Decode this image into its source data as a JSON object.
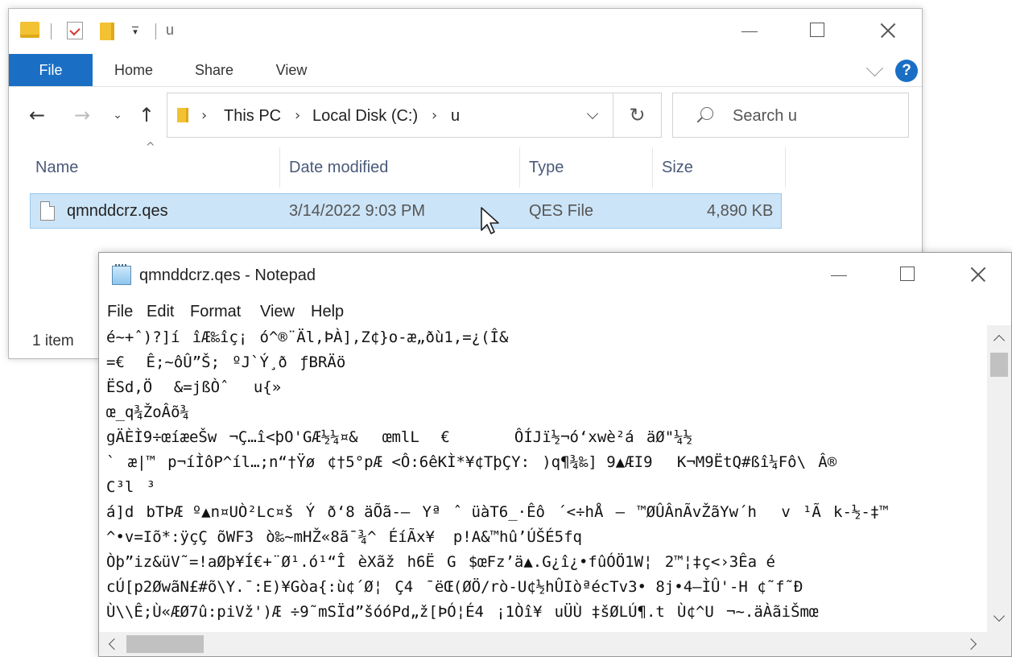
{
  "explorer": {
    "title": "u",
    "ribbon_tabs": [
      "File",
      "Home",
      "Share",
      "View"
    ],
    "help_label": "?",
    "breadcrumb": [
      "This PC",
      "Local Disk (C:)",
      "u"
    ],
    "search_placeholder": "Search u",
    "columns": [
      "Name",
      "Date modified",
      "Type",
      "Size"
    ],
    "files": [
      {
        "name": "qmnddcrz.qes",
        "date": "3/14/2022 9:03 PM",
        "type": "QES File",
        "size": "4,890 KB",
        "selected": true
      }
    ],
    "status": "1 item",
    "accent_color": "#1a6fc4",
    "selection_color": "#cce4f7"
  },
  "notepad": {
    "title": "qmnddcrz.qes - Notepad",
    "menu": [
      "File",
      "Edit",
      "Format",
      "View",
      "Help"
    ],
    "lines": [
      "é~+ˆ)?]íîÆ‰îç¡ó^®¨Äl,ÞÀ],Z¢}o-æ„ðù1,=¿(Î&",
      "=€ Ê;~ôÛ”Š;ºJ`Ý¸ðƒBRÄö",
      "ËSd,Ö &=jßÒˆu{»",
      "œ_q¾ŽoÂõ¾",
      "gÄÈÌ9÷œíæeŠw¬Ç…î<þO'GÆ½¼¤&œmlL €       ÔÍJï½¬ó‘xwè²áäØ\"¼½",
      "`æ|™p¬íÌôP^íl…;n“†Ÿø¢†5°pÆ <Ô:6êKÌ*¥¢TþÇY:)q¶¾‰] 9▲ÆI9K¬M9ËtQ#ßî¼Fô\\Â®",
      "C³l³",
      "á]dbTÞÆ º▲n¤UÒ²Lc¤šÝð‘8 äÕã-—Yªˆ üàT6_·Êô´<÷hÅ—™ØÛÂnÃvŽãYw´hv¹Ãk-½-‡™",
      "^•v=Iõ*:ÿçÇõWF3ò‰~mHŽ«8ã¯¾^ÉíÃx¥  p!A&™hû’ÚŠÉ5fq",
      "Òþ”iz&üV˜=!aØþ¥Í€+¨Ø¹.ó¹“ÎèXãžh6ËG$œFz’ä▲.G¿î¿•fûÓÖ1W¦2™¦‡ç<›3Êa é",
      "cÚ[p2ØwãN£#õ\\Y.¯:E)¥Gòa{:ù¢´Ø¦Ç4¯ëŒ(ØÖ/rò-U¢½hÛIòªécTv3• 8j•4—ÌÛ'-H ¢˜f˜Ð",
      "Ù\\\\Ê;Ù«ÆØ7û:piVž')Æ ÷9˜mSÏd”šóóPd„ž[ÞÓ¦É4¡1Òî¥uÜÙ ‡šØLÚ¶.tÙ¢^U¬~.äÀãiŠmœ"
    ]
  }
}
